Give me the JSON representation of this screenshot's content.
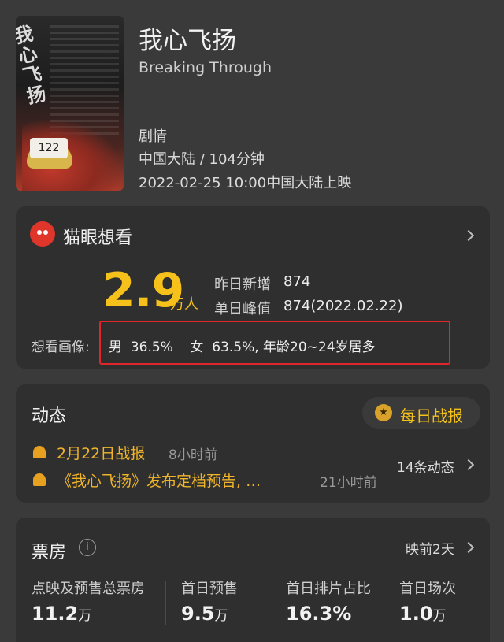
{
  "movie": {
    "title": "我心飞扬",
    "english_title": "Breaking Through",
    "genre": "剧情",
    "meta": "中国大陆 / 104分钟",
    "release": "2022-02-25  10:00中国大陆上映",
    "poster": {
      "title_text": "我心飞扬",
      "bib_number": "122"
    }
  },
  "want": {
    "title": "猫眼想看",
    "count": "2.9",
    "unit": "万人",
    "yesterday_label": "昨日新增",
    "yesterday_value": "874",
    "peak_label": "单日峰值",
    "peak_value": "874(2022.02.22)",
    "portrait_label": "想看画像:",
    "portrait_text": "男  36.5%    女  63.5%, 年龄20~24岁居多",
    "highlight_color": "#e0262b"
  },
  "news": {
    "title": "动态",
    "daily_button": "每日战报",
    "items": [
      {
        "text": "2月22日战报",
        "time": "8小时前"
      },
      {
        "text": "《我心飞扬》发布定档预告, …",
        "time": "21小时前"
      }
    ],
    "count_label": "14条动态"
  },
  "box_office": {
    "title": "票房",
    "status": "映前2天",
    "stats": [
      {
        "label": "点映及预售总票房",
        "value": "11.2",
        "unit": "万"
      },
      {
        "label": "首日预售",
        "value": "9.5",
        "unit": "万"
      },
      {
        "label": "首日排片占比",
        "value": "16.3%",
        "unit": ""
      },
      {
        "label": "首日场次",
        "value": "1.0",
        "unit": "万"
      }
    ]
  },
  "colors": {
    "accent": "#f5c11a",
    "background": "#3a3a3a",
    "card": "#2f2f2f"
  },
  "icons": [
    "maoyan-cat-icon",
    "chevron-right-icon",
    "medal-icon",
    "bell-icon",
    "info-icon"
  ]
}
